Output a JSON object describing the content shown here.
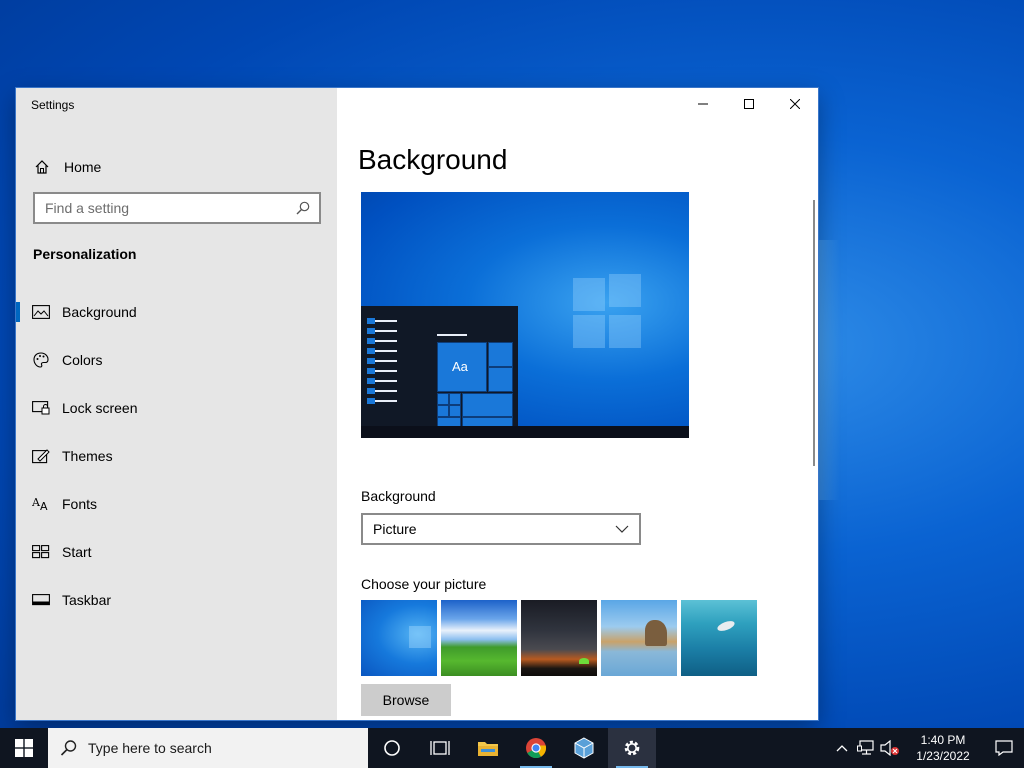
{
  "window": {
    "title": "Settings"
  },
  "sidebar": {
    "home_label": "Home",
    "search_placeholder": "Find a setting",
    "section_title": "Personalization",
    "items": [
      {
        "label": "Background",
        "icon": "picture-icon",
        "active": true
      },
      {
        "label": "Colors",
        "icon": "palette-icon"
      },
      {
        "label": "Lock screen",
        "icon": "lock-screen-icon"
      },
      {
        "label": "Themes",
        "icon": "brush-icon"
      },
      {
        "label": "Fonts",
        "icon": "fonts-icon"
      },
      {
        "label": "Start",
        "icon": "start-icon"
      },
      {
        "label": "Taskbar",
        "icon": "taskbar-icon"
      }
    ]
  },
  "main": {
    "page_title": "Background",
    "preview_sample_text": "Aa",
    "background_label": "Background",
    "background_value": "Picture",
    "choose_label": "Choose your picture",
    "browse_label": "Browse"
  },
  "taskbar": {
    "search_text": "Type here to search",
    "time": "1:40 PM",
    "date": "1/23/2022"
  },
  "colors": {
    "accent": "#0067c0",
    "sidebar_bg": "#e6e6e6",
    "taskbar_bg": "#0f1520"
  }
}
